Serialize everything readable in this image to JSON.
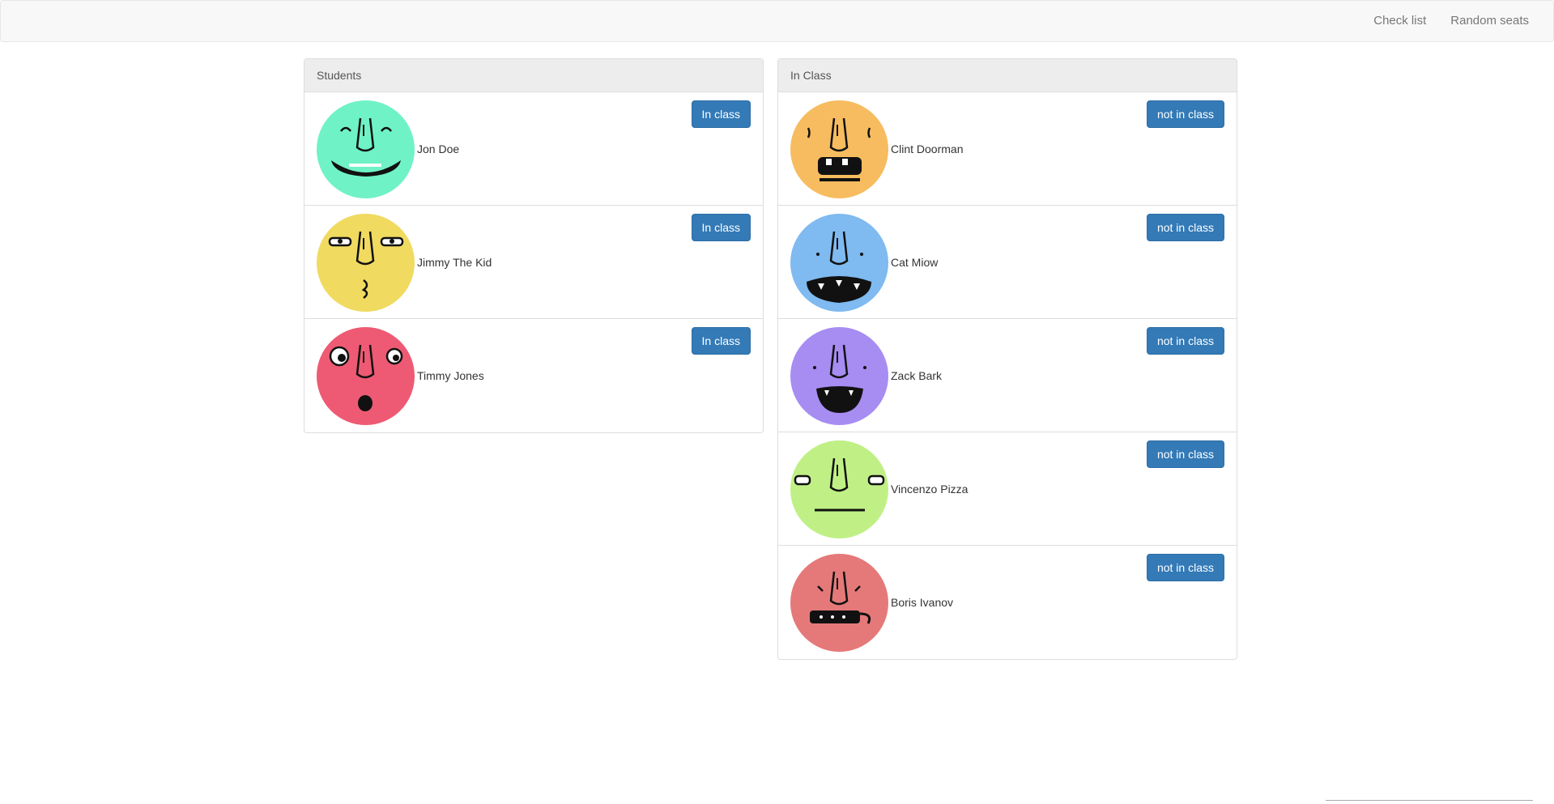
{
  "navbar": {
    "links": [
      {
        "label": "Check list"
      },
      {
        "label": "Random seats"
      }
    ]
  },
  "students_panel": {
    "title": "Students",
    "items": [
      {
        "name": "Jon Doe",
        "button": "In class",
        "color": "#6ff2c6",
        "face": "grin"
      },
      {
        "name": "Jimmy The Kid",
        "button": "In class",
        "color": "#f0da60",
        "face": "squint"
      },
      {
        "name": "Timmy Jones",
        "button": "In class",
        "color": "#ee5a73",
        "face": "surprised"
      }
    ]
  },
  "inclass_panel": {
    "title": "In Class",
    "items": [
      {
        "name": "Clint Doorman",
        "button": "not in class",
        "color": "#f7bc5f",
        "face": "teeth"
      },
      {
        "name": "Cat Miow",
        "button": "not in class",
        "color": "#7fbaf0",
        "face": "open"
      },
      {
        "name": "Zack Bark",
        "button": "not in class",
        "color": "#a78cf2",
        "face": "laugh"
      },
      {
        "name": "Vincenzo Pizza",
        "button": "not in class",
        "color": "#c0f085",
        "face": "flat"
      },
      {
        "name": "Boris Ivanov",
        "button": "not in class",
        "color": "#e57979",
        "face": "tongue"
      }
    ]
  },
  "theme": {
    "button_bg": "#337ab7",
    "navbar_bg": "#f8f8f8",
    "panel_heading_bg": "#ededed"
  }
}
